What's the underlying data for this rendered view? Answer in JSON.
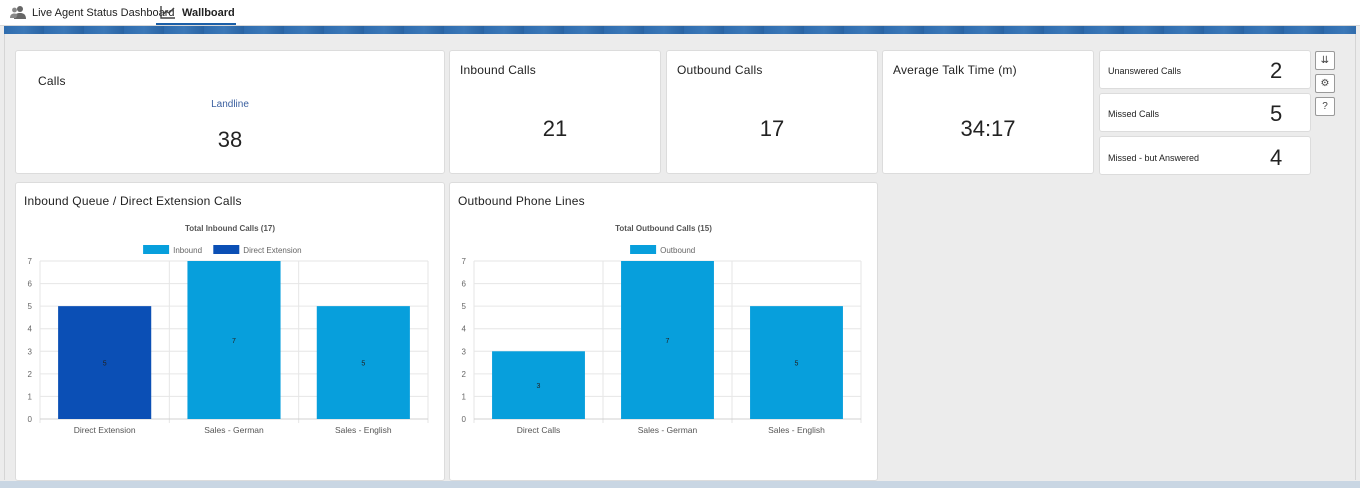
{
  "tabs": [
    {
      "label": "Live Agent Status Dashboard",
      "icon": "users-icon"
    },
    {
      "label": "Wallboard",
      "icon": "line-chart-icon"
    }
  ],
  "summary": {
    "calls": {
      "title": "Calls",
      "sub": "Landline",
      "value": "38"
    },
    "inbound": {
      "title": "Inbound Calls",
      "value": "21"
    },
    "outbound": {
      "title": "Outbound Calls",
      "value": "17"
    },
    "avg_talk": {
      "title": "Average Talk Time (m)",
      "value": "34:17"
    }
  },
  "side_stats": [
    {
      "label": "Unanswered Calls",
      "value": "2"
    },
    {
      "label": "Missed Calls",
      "value": "5"
    },
    {
      "label": "Missed - but Answered",
      "value": "4"
    }
  ],
  "side_buttons": [
    "list-sort-icon",
    "gear-icon",
    "help-icon"
  ],
  "side_button_glyphs": [
    "⇊",
    "⚙",
    "?"
  ],
  "panels": {
    "inbound_title": "Inbound Queue / Direct Extension Calls",
    "outbound_title": "Outbound Phone Lines"
  },
  "colors": {
    "inbound": "#079fdc",
    "direct_extension": "#0b4fb5",
    "outbound": "#079fdc"
  },
  "chart_data": [
    {
      "type": "bar",
      "title": "Total Inbound Calls (17)",
      "categories": [
        "Direct Extension",
        "Sales - German",
        "Sales - English"
      ],
      "series": [
        {
          "name": "Inbound",
          "values": [
            0,
            7,
            5
          ]
        },
        {
          "name": "Direct Extension",
          "values": [
            5,
            0,
            0
          ]
        }
      ],
      "data_labels": [
        "5",
        "7",
        "5"
      ],
      "ylim": [
        0,
        7
      ],
      "yticks": [
        "0",
        "1",
        "2",
        "3",
        "4",
        "5",
        "6",
        "7"
      ],
      "legend": "top",
      "grid": true
    },
    {
      "type": "bar",
      "title": "Total Outbound Calls (15)",
      "categories": [
        "Direct Calls",
        "Sales - German",
        "Sales - English"
      ],
      "series": [
        {
          "name": "Outbound",
          "values": [
            3,
            7,
            5
          ]
        }
      ],
      "data_labels": [
        "3",
        "7",
        "5"
      ],
      "ylim": [
        0,
        7
      ],
      "yticks": [
        "0",
        "1",
        "2",
        "3",
        "4",
        "5",
        "6",
        "7"
      ],
      "legend": "top",
      "grid": true
    }
  ]
}
